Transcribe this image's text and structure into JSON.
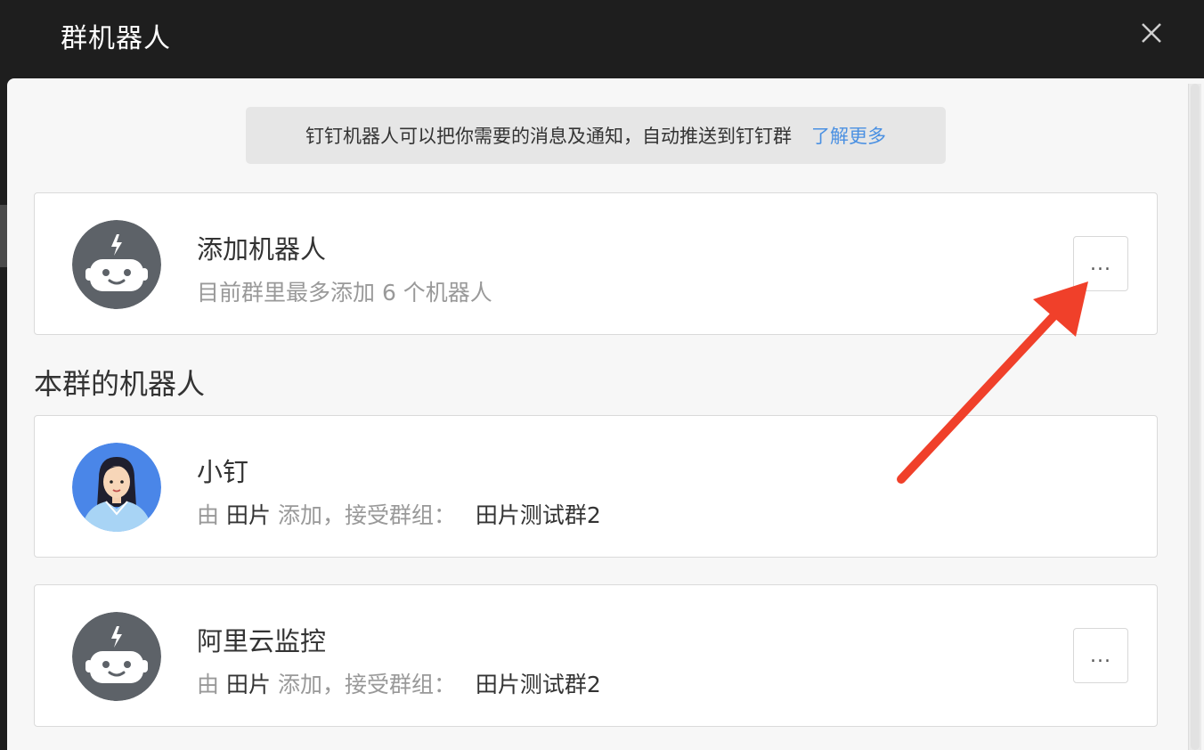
{
  "window": {
    "title": "群机器人"
  },
  "tip": {
    "text": "钉钉机器人可以把你需要的消息及通知，自动推送到钉钉群",
    "link": "了解更多"
  },
  "add_robot": {
    "title": "添加机器人",
    "subtitle": "目前群里最多添加 6 个机器人",
    "more": "..."
  },
  "section": {
    "title": "本群的机器人"
  },
  "robots": [
    {
      "name": "小钉",
      "by": "由",
      "adder": "田片",
      "added_text": "添加，接受群组：",
      "group": "田片测试群2"
    },
    {
      "name": "阿里云监控",
      "by": "由",
      "adder": "田片",
      "added_text": "添加，接受群组：",
      "group": "田片测试群2",
      "more": "..."
    }
  ],
  "colors": {
    "titlebar": "#1e1e1e",
    "link": "#4a90e2",
    "arrow": "#f0402a",
    "robot_avatar": "#5d6268"
  },
  "icons": {
    "close": "close-icon",
    "robot": "robot-icon",
    "arrow": "arrow-annotation"
  }
}
